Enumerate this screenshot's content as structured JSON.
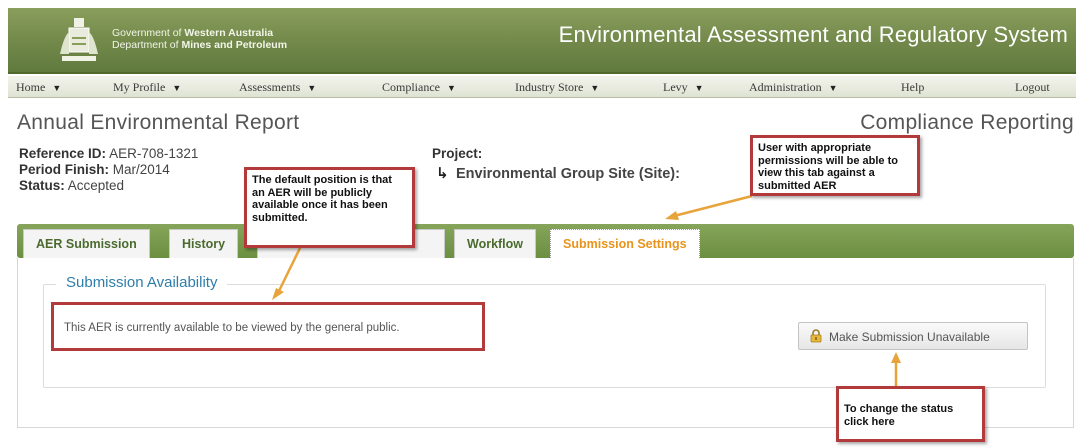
{
  "header": {
    "gov_line1_prefix": "Government of ",
    "gov_line1_bold": "Western Australia",
    "gov_line2_prefix": "Department of ",
    "gov_line2_bold": "Mines and Petroleum",
    "system_title": "Environmental Assessment and Regulatory System",
    "crest_icon": "wa-coat-of-arms-icon"
  },
  "nav": {
    "items": [
      {
        "label": "Home",
        "dropdown": true
      },
      {
        "label": "My Profile",
        "dropdown": true
      },
      {
        "label": "Assessments",
        "dropdown": true
      },
      {
        "label": "Compliance",
        "dropdown": true
      },
      {
        "label": "Industry Store",
        "dropdown": true
      },
      {
        "label": "Levy",
        "dropdown": true
      },
      {
        "label": "Administration",
        "dropdown": true
      },
      {
        "label": "Help",
        "dropdown": false
      },
      {
        "label": "Logout",
        "dropdown": false
      }
    ],
    "caret": "▼"
  },
  "page": {
    "title": "Annual Environmental Report",
    "section": "Compliance Reporting"
  },
  "info": {
    "reference_label": "Reference ID:",
    "reference_value": "AER-708-1321",
    "period_label": "Period Finish:",
    "period_value": "Mar/2014",
    "status_label": "Status:",
    "status_value": "Accepted",
    "project_label": "Project:",
    "site_label": "Environmental Group Site (Site):"
  },
  "tabs": [
    {
      "label": "AER Submission",
      "active": false
    },
    {
      "label": "History",
      "active": false
    },
    {
      "label": "Workflow",
      "active": false
    },
    {
      "label": "Submission Settings",
      "active": true
    }
  ],
  "panel": {
    "legend": "Submission Availability",
    "availability_text": "This AER is currently available to be viewed by the general public.",
    "button_label": "Make Submission Unavailable",
    "button_icon": "lock-icon"
  },
  "callouts": {
    "default_position": "The default position is that an AER will be publicly available once it has been submitted.",
    "permissions": "User with appropriate permissions will be able to view this tab against a submitted AER",
    "change_status": "To change the status click here"
  },
  "colors": {
    "header_green": "#71884a",
    "tab_green": "#6c8f41",
    "active_tab_text": "#e8941c",
    "callout_border": "#b23a3a",
    "annotation_line": "#e8a33a",
    "legend_blue": "#2e7eaa"
  }
}
